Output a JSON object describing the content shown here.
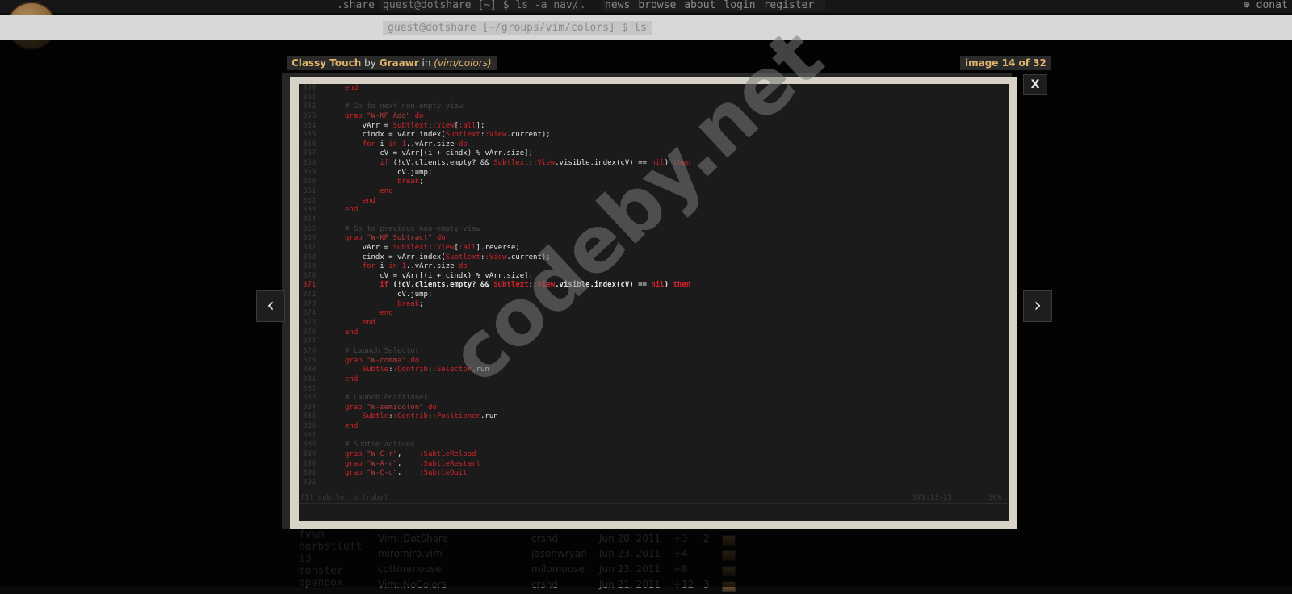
{
  "topbar": {
    "share": ".share",
    "prompt": "guest@dotshare [~] $ ls -a nav/",
    "nav_dots": "..",
    "links": [
      "news",
      "browse",
      "about",
      "login",
      "register"
    ],
    "donate": "donat"
  },
  "logo": "sh",
  "subbar": {
    "path": "guest@dotshare [~/groups/vim/colors] $ ls"
  },
  "left_list": [
    "fvwm",
    "herbstluft",
    "i3",
    "monster",
    "openbox"
  ],
  "table_rows": [
    {
      "name": "Vim::DotShare",
      "user": "crshd",
      "date": "Jun 28, 2011",
      "score": "+3",
      "comments": "2"
    },
    {
      "name": "miromiro.vim",
      "user": "jasonwryan",
      "date": "Jun 23, 2011",
      "score": "+4",
      "comments": ""
    },
    {
      "name": "cottonmouse",
      "user": "milomouse",
      "date": "Jun 23, 2011",
      "score": "+8",
      "comments": ""
    },
    {
      "name": "Vim::NoColors",
      "user": "crshd",
      "date": "Jun 21, 2011",
      "score": "+12",
      "comments": "3"
    }
  ],
  "lightbox": {
    "title": "Classy Touch",
    "by": "by",
    "author": "Graawr",
    "in": "in",
    "category": "(vim/colors)",
    "counter": "image 14 of 32",
    "close": "X",
    "prev": "‹",
    "next": "›",
    "watermark": "codeby.net"
  },
  "editor": {
    "lines": [
      {
        "n": "350",
        "code": "end"
      },
      {
        "n": "351",
        "code": ""
      },
      {
        "n": "352",
        "code": "# Go to next non-empty view"
      },
      {
        "n": "353",
        "code": "grab \"W-KP_Add\" do"
      },
      {
        "n": "354",
        "code": "    vArr = Subtlext::View[:all];"
      },
      {
        "n": "355",
        "code": "    cindx = vArr.index(Subtlext::View.current);"
      },
      {
        "n": "356",
        "code": "    for i in 1..vArr.size do"
      },
      {
        "n": "357",
        "code": "        cV = vArr[(i + cindx) % vArr.size];"
      },
      {
        "n": "358",
        "code": "        if (!cV.clients.empty? && Subtlext::View.visible.index(cV) == nil) then"
      },
      {
        "n": "359",
        "code": "            cV.jump;"
      },
      {
        "n": "360",
        "code": "            break;"
      },
      {
        "n": "361",
        "code": "        end"
      },
      {
        "n": "362",
        "code": "    end"
      },
      {
        "n": "363",
        "code": "end"
      },
      {
        "n": "364",
        "code": ""
      },
      {
        "n": "365",
        "code": "# Go to previous non-empty view"
      },
      {
        "n": "366",
        "code": "grab \"W-KP_Subtract\" do"
      },
      {
        "n": "367",
        "code": "    vArr = Subtlext::View[:all].reverse;"
      },
      {
        "n": "368",
        "code": "    cindx = vArr.index(Subtlext::View.current);"
      },
      {
        "n": "369",
        "code": "    for i in 1..vArr.size do"
      },
      {
        "n": "370",
        "code": "        cV = vArr[(i + cindx) % vArr.size];"
      },
      {
        "n": "371",
        "code": "        if (!cV.clients.empty? && Subtlext::View.visible.index(cV) == nil) then"
      },
      {
        "n": "372",
        "code": "            cV.jump;"
      },
      {
        "n": "373",
        "code": "            break;"
      },
      {
        "n": "374",
        "code": "        end"
      },
      {
        "n": "375",
        "code": "    end"
      },
      {
        "n": "376",
        "code": "end"
      },
      {
        "n": "377",
        "code": ""
      },
      {
        "n": "378",
        "code": "# Launch Selector"
      },
      {
        "n": "379",
        "code": "grab \"W-comma\" do"
      },
      {
        "n": "380",
        "code": "    Subtle::Contrib::Selector.run"
      },
      {
        "n": "381",
        "code": "end"
      },
      {
        "n": "382",
        "code": ""
      },
      {
        "n": "383",
        "code": "# Launch Positioner"
      },
      {
        "n": "384",
        "code": "grab \"W-semicolon\" do"
      },
      {
        "n": "385",
        "code": "    Subtle::Contrib::Positioner.run"
      },
      {
        "n": "386",
        "code": "end"
      },
      {
        "n": "387",
        "code": ""
      },
      {
        "n": "388",
        "code": "# Subtle actions"
      },
      {
        "n": "389",
        "code": "grab \"W-C-r\",    :SubtleReload"
      },
      {
        "n": "390",
        "code": "grab \"W-A-r\",    :SubtleRestart"
      },
      {
        "n": "391",
        "code": "grab \"W-C-q\",    :SubtleQuit"
      },
      {
        "n": "392",
        "code": ""
      }
    ],
    "current_line": "371",
    "status_left": "[1] subtle.rb [ruby]",
    "status_pos": "371,13-13",
    "status_pct": "56%"
  },
  "colors": {
    "accent": "#e0b46a",
    "keyword_red": "#d2232a",
    "editor_bg": "#1b1b1b",
    "frame": "#d6d2c6"
  }
}
